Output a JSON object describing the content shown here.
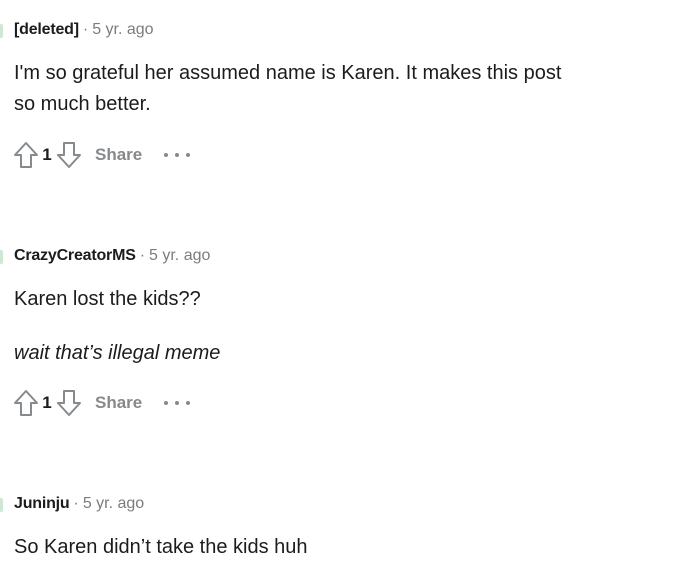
{
  "comments": [
    {
      "author": "[deleted]",
      "separator": "·",
      "time": "5 yr. ago",
      "body_line1": "I'm so grateful her assumed name is Karen. It makes this post",
      "body_line2": "so much better.",
      "score": "1",
      "share_label": "Share"
    },
    {
      "author": "CrazyCreatorMS",
      "separator": "·",
      "time": "5 yr. ago",
      "body_line1": "Karen lost the kids??",
      "body_line2": "wait that’s illegal meme",
      "score": "1",
      "share_label": "Share"
    },
    {
      "author": "Juninju",
      "separator": "·",
      "time": "5 yr. ago",
      "body_line1": "So Karen didn’t take the kids huh"
    }
  ],
  "icons": {
    "upvote": "arrow-up-outline",
    "downvote": "arrow-down-outline",
    "more": "ellipsis-horizontal"
  },
  "colors": {
    "text": "#1c1c1c",
    "muted": "#7c7c7c",
    "icon": "#878a8c",
    "thread_line": "#cfe8d6"
  }
}
